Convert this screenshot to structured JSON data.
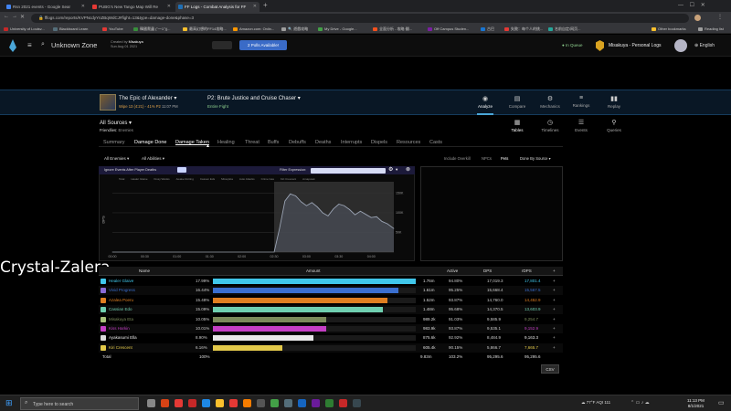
{
  "browser": {
    "tabs": [
      {
        "title": "Rsn 2021 events - Google Sear",
        "color": "#4285f4"
      },
      {
        "title": "PUBG's New Tango Map Will Re",
        "color": "#e53935"
      },
      {
        "title": "FF Logs - Combat Analysis for FF",
        "color": "#1f6fb5"
      }
    ],
    "new_tab": "+",
    "url": "fflogs.com/reports/KVPNcdyYnZBqWdCJ#fight=13&type=damage-done&phase=3",
    "bookmarks": [
      "University of Louisv...",
      "Blackboard Learn",
      "YouTube",
      "韓國爬蟲 (\"一1\")(...",
      "最高幻想的FF14攻略...",
      "Amazon.com: Onlin...",
      "🔍 遊戲攻略",
      "My Drive - Google...",
      "全面分析 - 攻略·翻...",
      "Off Campus Studen...",
      "古巴",
      "失敗：每个人的挑...",
      "名前自定/网页...",
      "Other bookmarks",
      "Reading list"
    ],
    "bookmark_colors": [
      "#c62828",
      "#546e7a",
      "#e53935",
      "#388e3c",
      "#fbc02d",
      "#ff9800",
      "#9e9e9e",
      "#43a047",
      "#f4511e",
      "#7b1fa2",
      "#1976d2",
      "#e53935",
      "#26a69a",
      "#fbc02d",
      "#9e9e9e"
    ]
  },
  "site": {
    "zone": "Unknown Zone",
    "created_by_label": "Created by",
    "creator": "Misakuya",
    "date": "Sun Aug 01 2021",
    "polls_button": "2 Polls Available!",
    "queue_status": "In Queue",
    "log_owner": "Misakuya - Personal Logs",
    "language": "English"
  },
  "fight": {
    "name": "The Epic of Alexander",
    "wipe_info": "Wipe 13 (4:21) - 41% P2",
    "pull_time": "11:07 PM",
    "phase_title": "P2: Brute Justice and Cruise Chaser",
    "phase_sub": "Entire Fight",
    "nav": [
      {
        "label": "Analyze",
        "icon": "eye-icon"
      },
      {
        "label": "Compare",
        "icon": "compare-icon"
      },
      {
        "label": "Mechanics",
        "icon": "mechanics-icon"
      },
      {
        "label": "Rankings",
        "icon": "rankings-icon"
      },
      {
        "label": "Replay",
        "icon": "replay-icon"
      }
    ]
  },
  "sources": {
    "all_sources": "All Sources",
    "friendlies_label": "Friendlies:",
    "enemies_label": "Enemies"
  },
  "views": [
    {
      "label": "Tables",
      "icon": "table-icon"
    },
    {
      "label": "Timelines",
      "icon": "clock-icon"
    },
    {
      "label": "Events",
      "icon": "list-icon"
    },
    {
      "label": "Queries",
      "icon": "pin-icon"
    }
  ],
  "tabs": [
    "Summary",
    "Damage Done",
    "Damage Taken",
    "Healing",
    "Threat",
    "Buffs",
    "Debuffs",
    "Deaths",
    "Interrupts",
    "Dispels",
    "Resources",
    "Casts"
  ],
  "filters": {
    "enemies": "All Enemies",
    "abilities": "All Abilities",
    "right": [
      "Include Overkill",
      "NPCs",
      "Pets",
      "Done By Source"
    ]
  },
  "chart": {
    "ignore_label": "Ignore Events After Player Deaths",
    "filter_label": "Filter Expression:",
    "legend": [
      "Total",
      "Healer Glaive",
      "Kissy Wanks",
      "Awake Rotting",
      "Cassen Eds",
      "Miraq Eta",
      "Auto Attacks",
      "Crime Gas",
      "Kiri Crescent",
      "Amapotek"
    ],
    "yaxis_label": "DPS"
  },
  "chart_data": {
    "type": "area",
    "x": [
      "00:00",
      "00:30",
      "01:00",
      "01:30",
      "02:00",
      "02:30",
      "02:35",
      "02:40",
      "02:45",
      "02:50",
      "02:55",
      "03:00",
      "03:05",
      "03:10",
      "03:15",
      "03:20",
      "03:25",
      "03:30",
      "03:35",
      "03:40",
      "03:45",
      "03:50",
      "03:55",
      "04:00",
      "04:05",
      "04:10",
      "04:15",
      "04:21"
    ],
    "xticks": [
      "00:00",
      "00:30",
      "01:00",
      "01:30",
      "02:00",
      "02:30",
      "03:00",
      "03:30",
      "04:00"
    ],
    "values": [
      0,
      0,
      0,
      0,
      0,
      0,
      60000,
      130000,
      148000,
      143000,
      128000,
      118000,
      126000,
      115000,
      100000,
      92000,
      110000,
      122000,
      118000,
      108000,
      95000,
      104000,
      96000,
      88000,
      90000,
      78000,
      72000,
      60000
    ],
    "yticks": [
      "50K",
      "100K",
      "150K"
    ],
    "ytick_values": [
      50000,
      100000,
      150000
    ],
    "ylim": [
      0,
      165000
    ],
    "ylabel": "DPS",
    "color": "#9aa3b3"
  },
  "table": {
    "headers": [
      "Name",
      "Amount",
      "Active",
      "DPS",
      "rDPS"
    ],
    "rows": [
      {
        "name": "Healer Glaive",
        "pct": "17.99%",
        "amount": "1.76m",
        "active": "94.80%",
        "dps": "17,019.3",
        "rdps": "17,801.4",
        "color": "#40c7eb",
        "share": 100,
        "job_color": "#40c7eb"
      },
      {
        "name": "Vivid Progress",
        "pct": "16.44%",
        "amount": "1.61m",
        "active": "95.25%",
        "dps": "15,668.4",
        "rdps": "15,567.5",
        "color": "#3b6fcf",
        "share": 91.4,
        "job_color": "#8a6bd6"
      },
      {
        "name": "Azalea Poeru",
        "pct": "15.48%",
        "amount": "1.52m",
        "active": "93.87%",
        "dps": "14,760.0",
        "rdps": "14,452.9",
        "color": "#e07f21",
        "share": 86.1,
        "job_color": "#e07f21"
      },
      {
        "name": "Cassian Edo",
        "pct": "15.09%",
        "amount": "1.48m",
        "active": "95.68%",
        "dps": "14,370.5",
        "rdps": "13,603.9",
        "color": "#6fcfb0",
        "share": 83.9,
        "job_color": "#6fcfb0"
      },
      {
        "name": "Misakuya Eta",
        "pct": "10.05%",
        "amount": "989.2k",
        "active": "91.03%",
        "dps": "9,585.9",
        "rdps": "9,254.7",
        "color": "#7b8a5a",
        "share": 55.9,
        "job_color": "#a8c27a"
      },
      {
        "name": "Kiss Harkin",
        "pct": "10.01%",
        "amount": "983.9k",
        "active": "93.87%",
        "dps": "9,535.1",
        "rdps": "9,152.9",
        "color": "#c43fc4",
        "share": 55.7,
        "job_color": "#c43fc4"
      },
      {
        "name": "Ayakasumi Ella",
        "pct": "8.90%",
        "amount": "875.6k",
        "active": "92.92%",
        "dps": "8,484.9",
        "rdps": "9,163.3",
        "color": "#e8e8e8",
        "share": 49.5,
        "job_color": "#dddddd"
      },
      {
        "name": "Kiri Crescent",
        "pct": "6.16%",
        "amount": "605.4k",
        "active": "90.15%",
        "dps": "5,866.7",
        "rdps": "7,665.7",
        "color": "#e3c94a",
        "share": 34.3,
        "job_color": "#e3c94a"
      }
    ],
    "total": {
      "name": "Total",
      "pct": "100%",
      "amount": "9.83m",
      "active": "103.2%",
      "dps": "95,295.6",
      "rdps": "95,295.6"
    },
    "csv_button": "CSV"
  },
  "overlay_text": "Crystal-Zalera",
  "taskbar": {
    "search_placeholder": "Type here to search",
    "weather": "77°F",
    "aqi": "AQI 111",
    "time": "11:13 PM",
    "date": "8/1/2021"
  }
}
